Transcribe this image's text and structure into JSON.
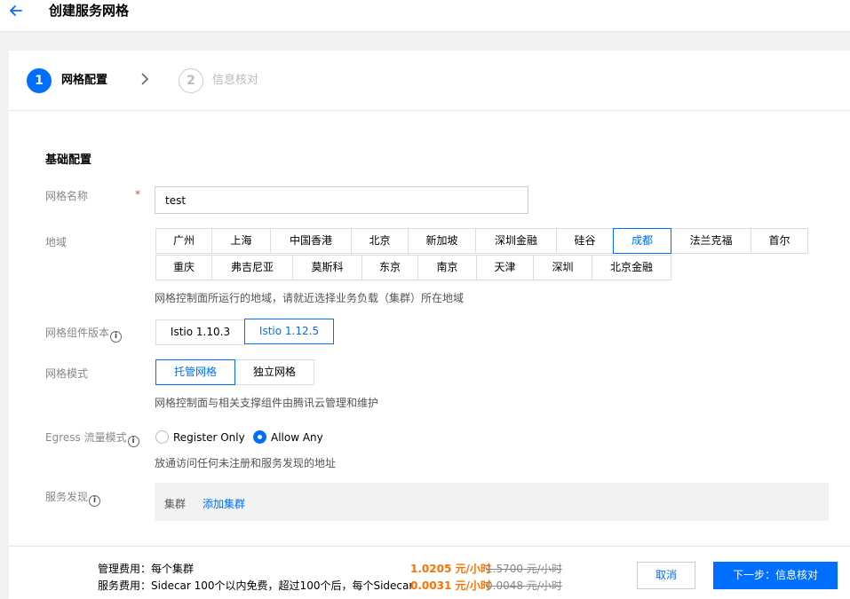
{
  "header": {
    "title": "创建服务网格",
    "back_icon": "arrow-left-icon"
  },
  "steps": [
    {
      "num": "1",
      "label": "网格配置",
      "active": true
    },
    {
      "num": "2",
      "label": "信息核对",
      "active": false
    }
  ],
  "form": {
    "section_title": "基础配置",
    "name": {
      "label": "网格名称",
      "required_mark": "*",
      "value": "test"
    },
    "region": {
      "label": "地域",
      "row1": [
        "广州",
        "上海",
        "中国香港",
        "北京",
        "新加坡",
        "深圳金融",
        "硅谷",
        "成都",
        "法兰克福",
        "首尔"
      ],
      "row2": [
        "重庆",
        "弗吉尼亚",
        "莫斯科",
        "东京",
        "南京",
        "天津",
        "深圳",
        "北京金融"
      ],
      "selected": "成都",
      "hint": "网格控制面所运行的地域，请就近选择业务负载（集群）所在地域"
    },
    "version": {
      "label": "网格组件版本",
      "info": "i",
      "options": [
        "Istio 1.10.3",
        "Istio 1.12.5"
      ],
      "selected": "Istio 1.12.5"
    },
    "mode": {
      "label": "网格模式",
      "options": [
        "托管网格",
        "独立网格"
      ],
      "selected": "托管网格",
      "hint": "网格控制面与相关支撑组件由腾讯云管理和维护"
    },
    "egress": {
      "label": "Egress 流量模式",
      "info": "i",
      "options": [
        "Register Only",
        "Allow Any"
      ],
      "selected": "Allow Any",
      "hint": "放通访问任何未注册和服务发现的地址"
    },
    "discovery": {
      "label": "服务发现",
      "info": "i",
      "cluster_label": "集群",
      "add_cluster": "添加集群"
    }
  },
  "footer": {
    "mgmt_fee_label": "管理费用：每个集群",
    "mgmt_fee_price": "1.0205 元/小时",
    "mgmt_fee_old": "1.5700 元/小时",
    "svc_fee_label": "服务费用：Sidecar 100个以内免费，超过100个后，每个Sidecar",
    "svc_fee_price": "0.0031 元/小时",
    "svc_fee_old": "0.0048 元/小时",
    "cancel": "取消",
    "next": "下一步：信息核对"
  },
  "colors": {
    "accent": "#006eff",
    "price": "#ff7200",
    "required": "#e54545"
  }
}
